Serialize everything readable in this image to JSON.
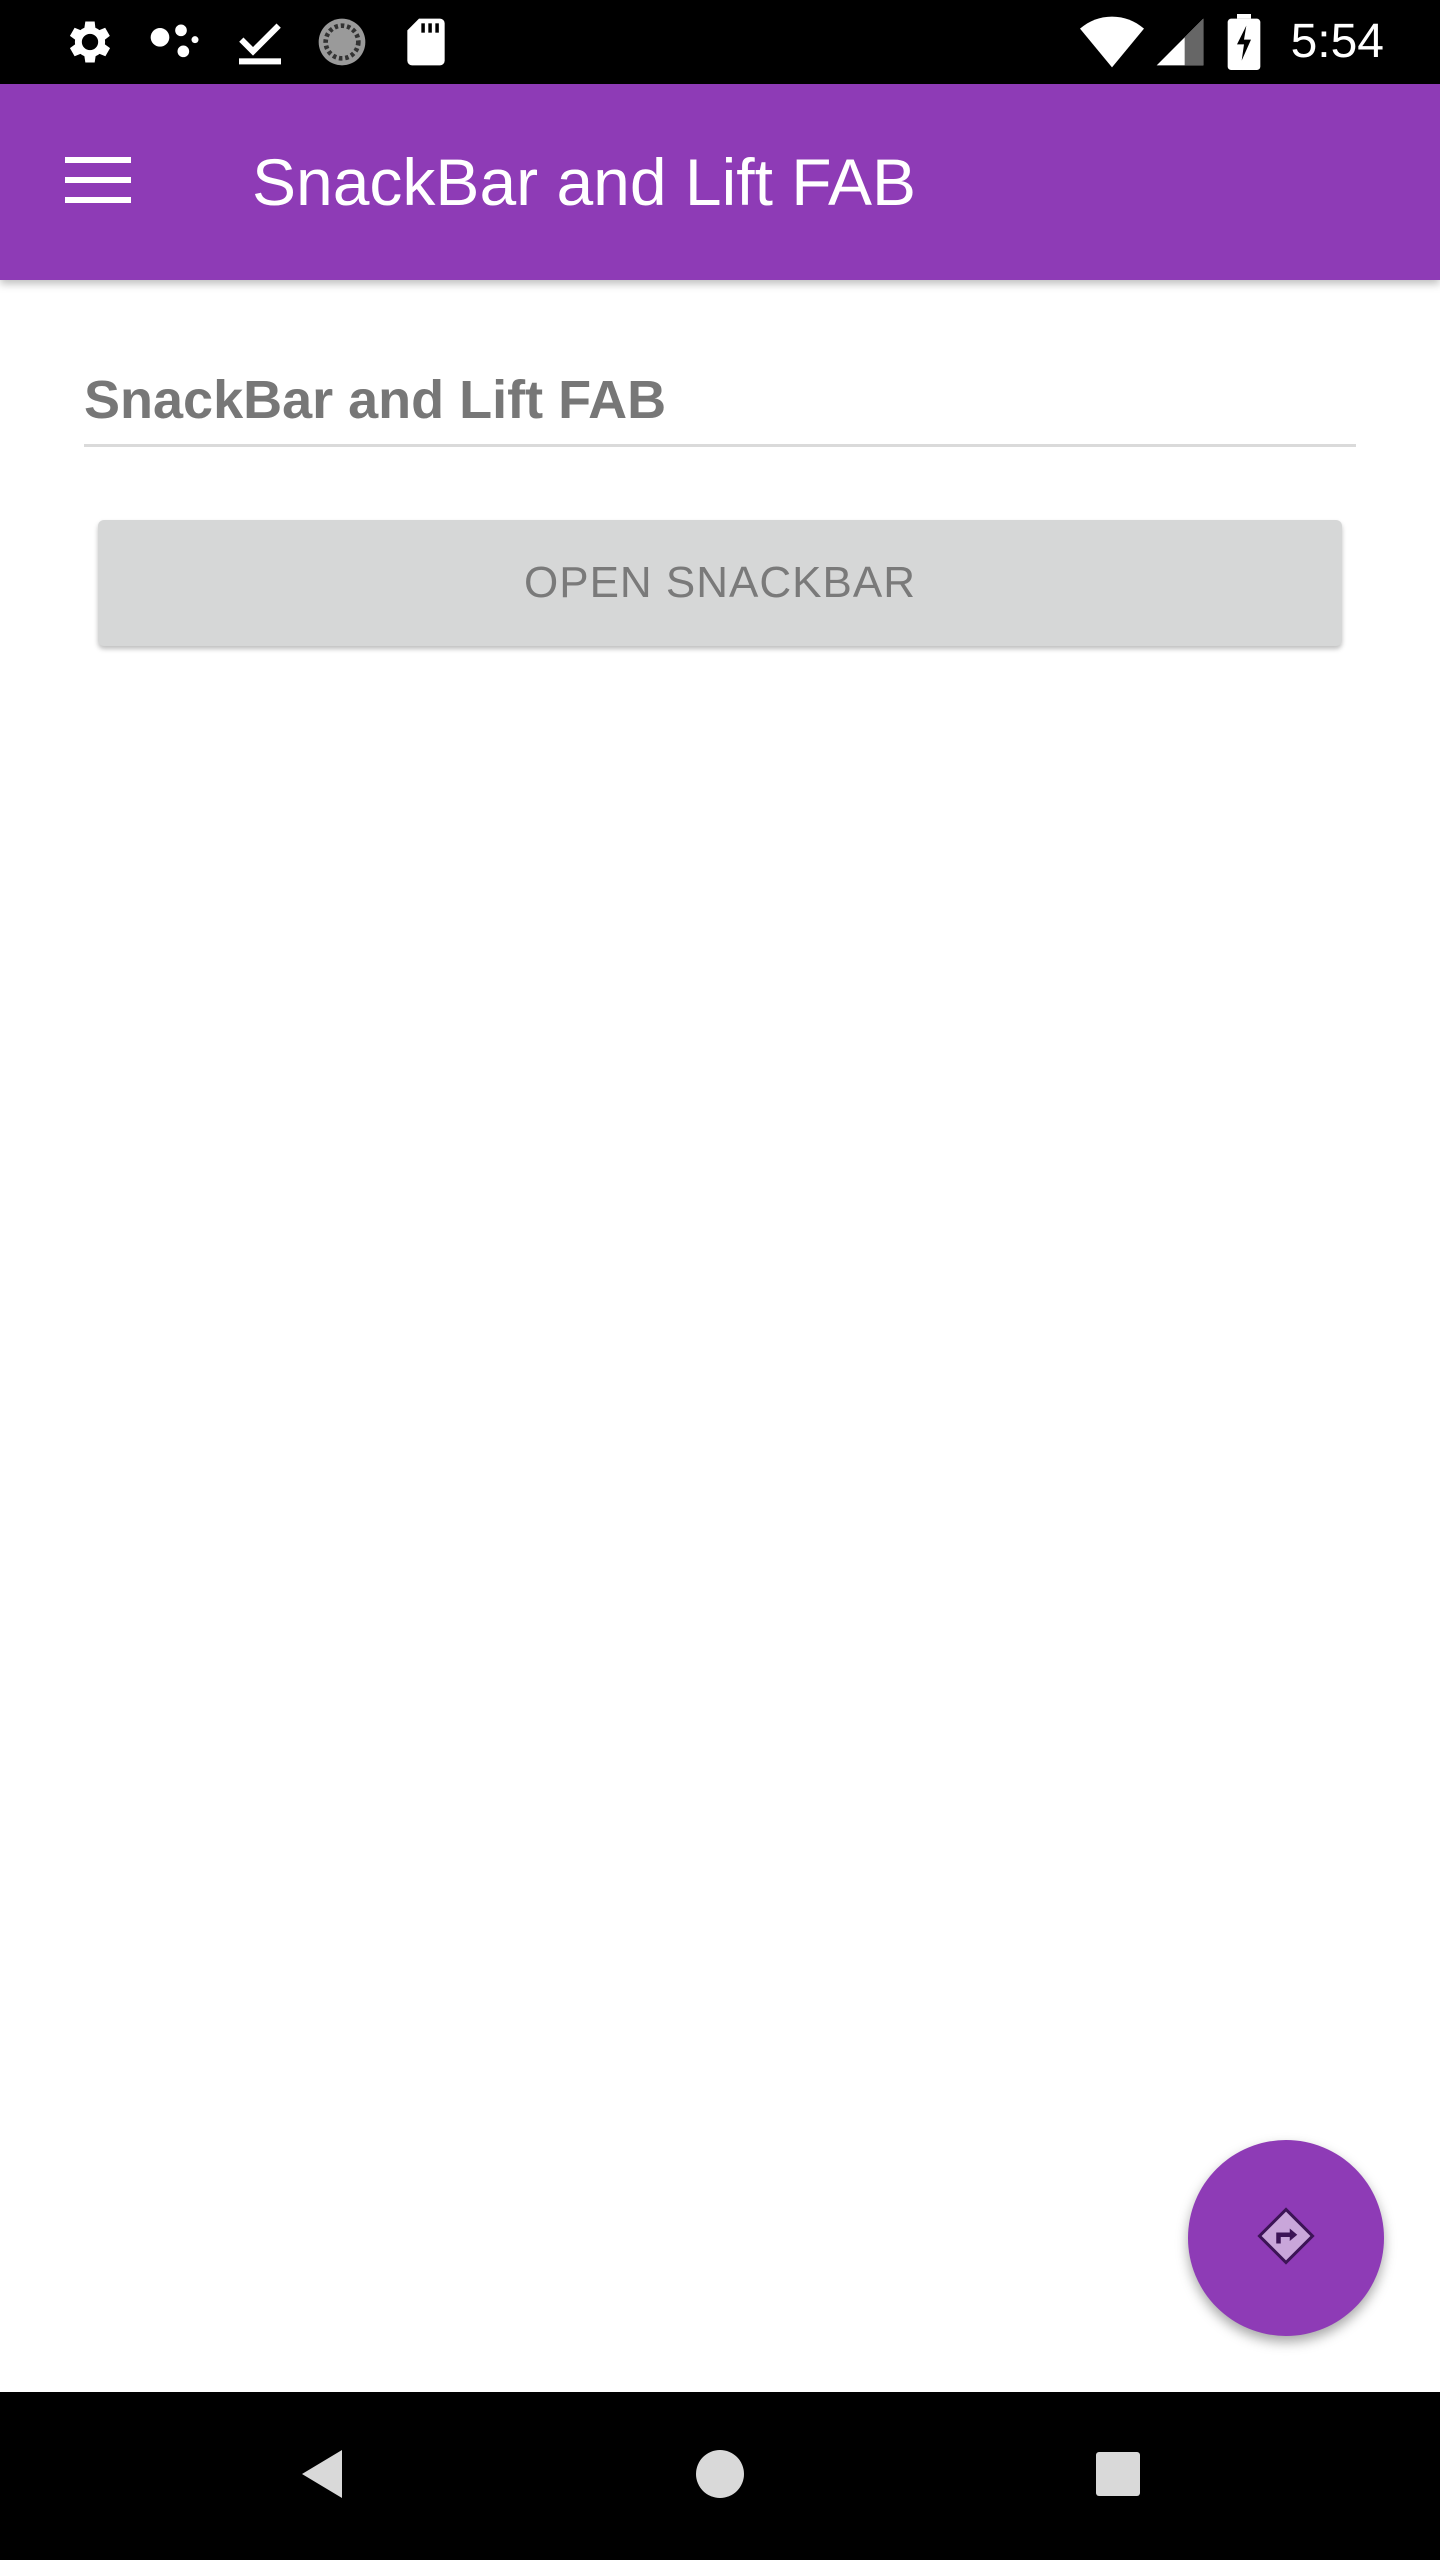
{
  "status_bar": {
    "time": "5:54",
    "left_icons": [
      "settings-icon",
      "share-dots-icon",
      "download-done-icon",
      "loading-spinner-icon",
      "sd-card-icon"
    ],
    "right_icons": [
      "wifi-icon",
      "signal-icon",
      "battery-charging-icon"
    ]
  },
  "app_bar": {
    "title": "SnackBar and Lift FAB",
    "nav_icon": "menu-icon",
    "color": "#8e3bb6"
  },
  "content": {
    "text_field": {
      "value": "SnackBar and Lift FAB"
    },
    "open_button": {
      "label": "OPEN SNACKBAR"
    }
  },
  "fab": {
    "icon": "directions-icon",
    "color": "#8e3bb6"
  },
  "nav_bar": {
    "buttons": [
      "back-icon",
      "home-icon",
      "recents-icon"
    ]
  }
}
